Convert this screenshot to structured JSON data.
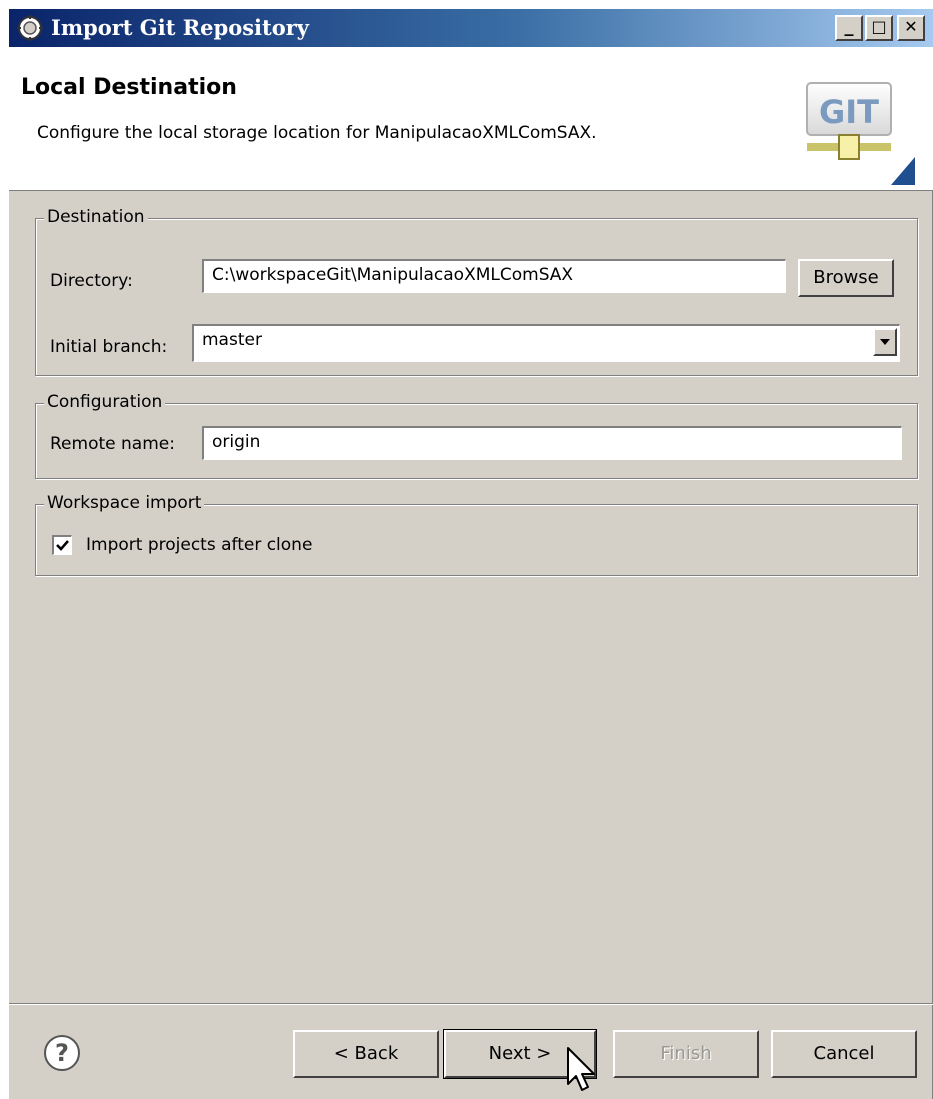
{
  "window": {
    "title": "Import Git Repository",
    "min_glyph": "_",
    "max_glyph": "□",
    "close_glyph": "✕"
  },
  "header": {
    "title": "Local Destination",
    "description": "Configure the local storage location for ManipulacaoXMLComSAX.",
    "logo_text": "GIT"
  },
  "destination": {
    "group_label": "Destination",
    "directory_label": "Directory:",
    "directory_value": "C:\\workspaceGit\\ManipulacaoXMLComSAX",
    "browse_label": "Browse",
    "branch_label": "Initial branch:",
    "branch_value": "master"
  },
  "configuration": {
    "group_label": "Configuration",
    "remote_label": "Remote name:",
    "remote_value": "origin"
  },
  "workspace_import": {
    "group_label": "Workspace import",
    "checkbox_label": "Import projects after clone",
    "checked": true
  },
  "footer": {
    "help_icon": "help-icon",
    "back_label": "< Back",
    "next_label": "Next >",
    "finish_label": "Finish",
    "cancel_label": "Cancel"
  },
  "colors": {
    "title_bar_start": "#0a246a",
    "title_bar_end": "#a6caf0",
    "dialog_background": "#d4d0c8",
    "git_logo_green": "#5a9a3a"
  }
}
